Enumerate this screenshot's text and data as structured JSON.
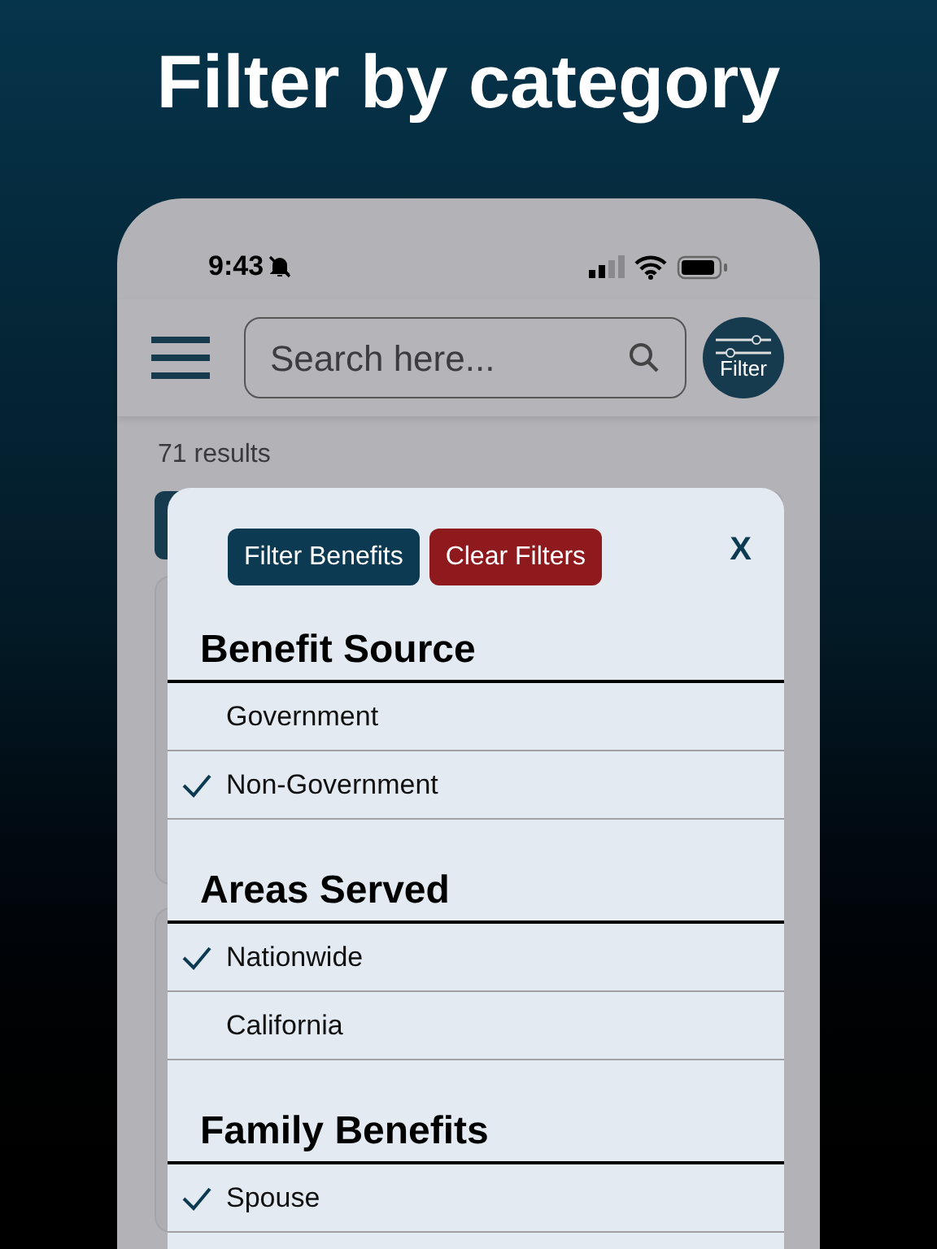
{
  "headline": "Filter by category",
  "status_bar": {
    "time": "9:43"
  },
  "search": {
    "placeholder": "Search here..."
  },
  "filter_button": {
    "label": "Filter"
  },
  "results": "71 results",
  "modal": {
    "buttons": [
      {
        "kind": "primary",
        "label": "Filter Benefits"
      },
      {
        "kind": "danger",
        "label": "Clear Filters"
      }
    ],
    "close": "X",
    "sections": [
      {
        "title": "Benefit Source",
        "options": [
          {
            "label": "Government",
            "checked": false
          },
          {
            "label": "Non-Government",
            "checked": true
          }
        ]
      },
      {
        "title": "Areas Served",
        "options": [
          {
            "label": "Nationwide",
            "checked": true
          },
          {
            "label": "California",
            "checked": false
          }
        ]
      },
      {
        "title": "Family Benefits",
        "options": [
          {
            "label": "Spouse",
            "checked": true
          }
        ]
      }
    ]
  }
}
